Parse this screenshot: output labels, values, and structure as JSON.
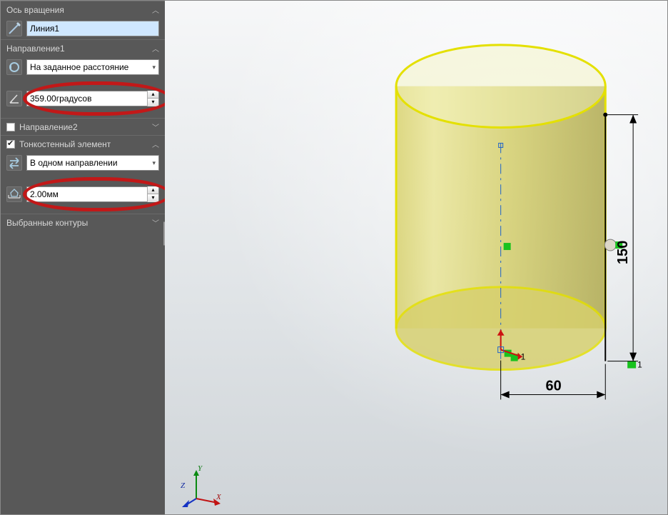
{
  "panel": {
    "axis": {
      "title": "Ось вращения",
      "value": "Линия1"
    },
    "dir1": {
      "title": "Направление1",
      "type": "На заданное расстояние",
      "angle": "359.00градусов"
    },
    "dir2": {
      "title": "Направление2"
    },
    "thin": {
      "title": "Тонкостенный элемент",
      "mode": "В одном направлении",
      "thickness": "2.00мм"
    },
    "contours": {
      "title": "Выбранные контуры"
    }
  },
  "dimensions": {
    "width": "60",
    "height": "150"
  },
  "triad": {
    "x": "X",
    "y": "Y",
    "z": "Z"
  }
}
